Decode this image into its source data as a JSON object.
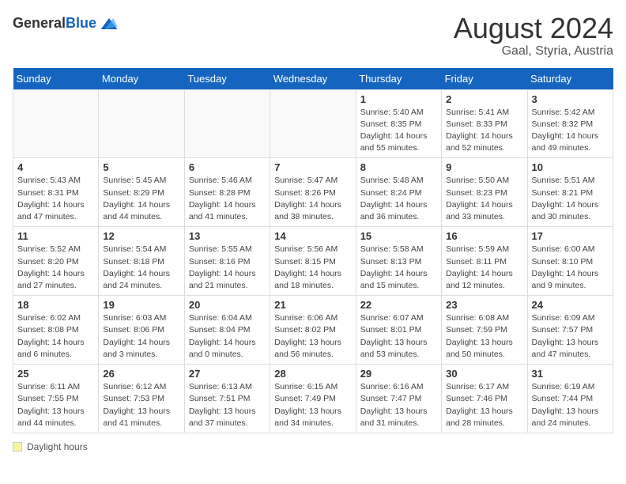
{
  "header": {
    "logo_general": "General",
    "logo_blue": "Blue",
    "month_title": "August 2024",
    "location": "Gaal, Styria, Austria"
  },
  "days_of_week": [
    "Sunday",
    "Monday",
    "Tuesday",
    "Wednesday",
    "Thursday",
    "Friday",
    "Saturday"
  ],
  "footer": {
    "label": "Daylight hours"
  },
  "weeks": [
    [
      {
        "day": "",
        "info": ""
      },
      {
        "day": "",
        "info": ""
      },
      {
        "day": "",
        "info": ""
      },
      {
        "day": "",
        "info": ""
      },
      {
        "day": "1",
        "info": "Sunrise: 5:40 AM\nSunset: 8:35 PM\nDaylight: 14 hours\nand 55 minutes."
      },
      {
        "day": "2",
        "info": "Sunrise: 5:41 AM\nSunset: 8:33 PM\nDaylight: 14 hours\nand 52 minutes."
      },
      {
        "day": "3",
        "info": "Sunrise: 5:42 AM\nSunset: 8:32 PM\nDaylight: 14 hours\nand 49 minutes."
      }
    ],
    [
      {
        "day": "4",
        "info": "Sunrise: 5:43 AM\nSunset: 8:31 PM\nDaylight: 14 hours\nand 47 minutes."
      },
      {
        "day": "5",
        "info": "Sunrise: 5:45 AM\nSunset: 8:29 PM\nDaylight: 14 hours\nand 44 minutes."
      },
      {
        "day": "6",
        "info": "Sunrise: 5:46 AM\nSunset: 8:28 PM\nDaylight: 14 hours\nand 41 minutes."
      },
      {
        "day": "7",
        "info": "Sunrise: 5:47 AM\nSunset: 8:26 PM\nDaylight: 14 hours\nand 38 minutes."
      },
      {
        "day": "8",
        "info": "Sunrise: 5:48 AM\nSunset: 8:24 PM\nDaylight: 14 hours\nand 36 minutes."
      },
      {
        "day": "9",
        "info": "Sunrise: 5:50 AM\nSunset: 8:23 PM\nDaylight: 14 hours\nand 33 minutes."
      },
      {
        "day": "10",
        "info": "Sunrise: 5:51 AM\nSunset: 8:21 PM\nDaylight: 14 hours\nand 30 minutes."
      }
    ],
    [
      {
        "day": "11",
        "info": "Sunrise: 5:52 AM\nSunset: 8:20 PM\nDaylight: 14 hours\nand 27 minutes."
      },
      {
        "day": "12",
        "info": "Sunrise: 5:54 AM\nSunset: 8:18 PM\nDaylight: 14 hours\nand 24 minutes."
      },
      {
        "day": "13",
        "info": "Sunrise: 5:55 AM\nSunset: 8:16 PM\nDaylight: 14 hours\nand 21 minutes."
      },
      {
        "day": "14",
        "info": "Sunrise: 5:56 AM\nSunset: 8:15 PM\nDaylight: 14 hours\nand 18 minutes."
      },
      {
        "day": "15",
        "info": "Sunrise: 5:58 AM\nSunset: 8:13 PM\nDaylight: 14 hours\nand 15 minutes."
      },
      {
        "day": "16",
        "info": "Sunrise: 5:59 AM\nSunset: 8:11 PM\nDaylight: 14 hours\nand 12 minutes."
      },
      {
        "day": "17",
        "info": "Sunrise: 6:00 AM\nSunset: 8:10 PM\nDaylight: 14 hours\nand 9 minutes."
      }
    ],
    [
      {
        "day": "18",
        "info": "Sunrise: 6:02 AM\nSunset: 8:08 PM\nDaylight: 14 hours\nand 6 minutes."
      },
      {
        "day": "19",
        "info": "Sunrise: 6:03 AM\nSunset: 8:06 PM\nDaylight: 14 hours\nand 3 minutes."
      },
      {
        "day": "20",
        "info": "Sunrise: 6:04 AM\nSunset: 8:04 PM\nDaylight: 14 hours\nand 0 minutes."
      },
      {
        "day": "21",
        "info": "Sunrise: 6:06 AM\nSunset: 8:02 PM\nDaylight: 13 hours\nand 56 minutes."
      },
      {
        "day": "22",
        "info": "Sunrise: 6:07 AM\nSunset: 8:01 PM\nDaylight: 13 hours\nand 53 minutes."
      },
      {
        "day": "23",
        "info": "Sunrise: 6:08 AM\nSunset: 7:59 PM\nDaylight: 13 hours\nand 50 minutes."
      },
      {
        "day": "24",
        "info": "Sunrise: 6:09 AM\nSunset: 7:57 PM\nDaylight: 13 hours\nand 47 minutes."
      }
    ],
    [
      {
        "day": "25",
        "info": "Sunrise: 6:11 AM\nSunset: 7:55 PM\nDaylight: 13 hours\nand 44 minutes."
      },
      {
        "day": "26",
        "info": "Sunrise: 6:12 AM\nSunset: 7:53 PM\nDaylight: 13 hours\nand 41 minutes."
      },
      {
        "day": "27",
        "info": "Sunrise: 6:13 AM\nSunset: 7:51 PM\nDaylight: 13 hours\nand 37 minutes."
      },
      {
        "day": "28",
        "info": "Sunrise: 6:15 AM\nSunset: 7:49 PM\nDaylight: 13 hours\nand 34 minutes."
      },
      {
        "day": "29",
        "info": "Sunrise: 6:16 AM\nSunset: 7:47 PM\nDaylight: 13 hours\nand 31 minutes."
      },
      {
        "day": "30",
        "info": "Sunrise: 6:17 AM\nSunset: 7:46 PM\nDaylight: 13 hours\nand 28 minutes."
      },
      {
        "day": "31",
        "info": "Sunrise: 6:19 AM\nSunset: 7:44 PM\nDaylight: 13 hours\nand 24 minutes."
      }
    ]
  ]
}
